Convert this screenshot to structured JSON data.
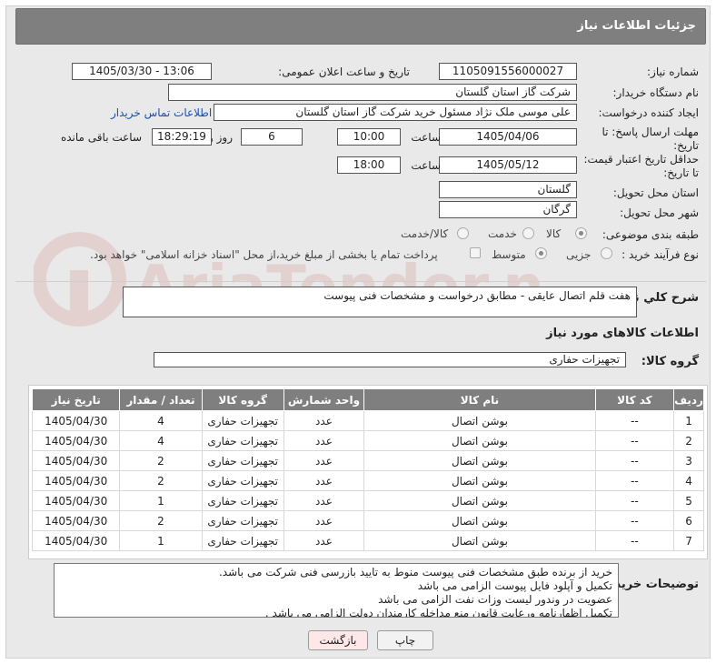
{
  "header": {
    "title": "جزئیات اطلاعات نیاز"
  },
  "fields": {
    "need_number_label": "شماره نیاز:",
    "need_number": "1105091556000027",
    "announce_label": "تاریخ و ساعت اعلان عمومی:",
    "announce_value": "1405/03/30 - 13:06",
    "buyer_org_label": "نام دستگاه خریدار:",
    "buyer_org": "شرکت گاز استان گلستان",
    "requester_label": "ایجاد کننده درخواست:",
    "requester": "علی موسی ملک نژاد مسئول خرید شرکت گاز استان گلستان",
    "contact_link": "اطلاعات تماس خریدار",
    "deadline_label_1": "مهلت ارسال پاسخ: تا",
    "deadline_label_2": "تاریخ:",
    "deadline_date": "1405/04/06",
    "time_label": "ساعت",
    "deadline_time": "10:00",
    "days_value": "6",
    "days_label": "روز و",
    "remaining_time": "18:29:19",
    "remaining_label": "ساعت باقی مانده",
    "validity_label_1": "حداقل تاریخ اعتبار قیمت:",
    "validity_label_2": "تا تاریخ:",
    "validity_date": "1405/05/12",
    "validity_time": "18:00",
    "province_label": "استان محل تحویل:",
    "province": "گلستان",
    "city_label": "شهر محل تحویل:",
    "city": "گرگان",
    "category_label": "طبقه بندی موضوعی:",
    "category_options": [
      "کالا",
      "خدمت",
      "کالا/خدمت"
    ],
    "category_selected": "کالا",
    "process_label": "نوع فرآیند خرید :",
    "process_options": [
      "جزیی",
      "متوسط"
    ],
    "process_selected": "متوسط",
    "payment_note": "پرداخت تمام یا بخشی از مبلغ خرید،از محل \"اسناد خزانه اسلامی\" خواهد بود."
  },
  "summary": {
    "label": "شرح کلي نياز:",
    "value": "هفت قلم اتصال عایقی - مطابق درخواست و مشخصات فنی پیوست"
  },
  "goods_section": {
    "title": "اطلاعات کالاهای مورد نیاز",
    "group_label": "گروه کالا:",
    "group_value": "تجهیزات حفاری"
  },
  "table": {
    "headers": [
      "ردیف",
      "کد کالا",
      "نام کالا",
      "واحد شمارش",
      "گروه کالا",
      "تعداد / مقدار",
      "تاریخ نیاز"
    ],
    "rows": [
      [
        "1",
        "--",
        "بوشن اتصال",
        "عدد",
        "تجهیزات حفاری",
        "4",
        "1405/04/30"
      ],
      [
        "2",
        "--",
        "بوشن اتصال",
        "عدد",
        "تجهیزات حفاری",
        "4",
        "1405/04/30"
      ],
      [
        "3",
        "--",
        "بوشن اتصال",
        "عدد",
        "تجهیزات حفاری",
        "2",
        "1405/04/30"
      ],
      [
        "4",
        "--",
        "بوشن اتصال",
        "عدد",
        "تجهیزات حفاری",
        "2",
        "1405/04/30"
      ],
      [
        "5",
        "--",
        "بوشن اتصال",
        "عدد",
        "تجهیزات حفاری",
        "1",
        "1405/04/30"
      ],
      [
        "6",
        "--",
        "بوشن اتصال",
        "عدد",
        "تجهیزات حفاری",
        "2",
        "1405/04/30"
      ],
      [
        "7",
        "--",
        "بوشن اتصال",
        "عدد",
        "تجهیزات حفاری",
        "1",
        "1405/04/30"
      ]
    ]
  },
  "notes": {
    "label": "توضیحات خریدار:",
    "lines": [
      "خرید از برنده طبق مشخصات فنی پیوست منوط به تایید بازرسی فنی شرکت می باشد.",
      "تکمیل و آپلود فایل پیوست الزامی می باشد",
      "عضویت در وندور لیست وزات نفت  الزامی می باشد",
      "تکمیل اظهارنامه ورعایت قانون منع مداخله کارمندان دولت الزامی می باشد ."
    ]
  },
  "buttons": {
    "back": "بازگشت",
    "print": "چاپ"
  },
  "watermark": {
    "text": "AriaTender.neT"
  },
  "colors": {
    "header_bg": "#7f7f7f",
    "panel_bg": "#e9e9e9",
    "link": "#1a4fb3",
    "back_btn_bg": "#fde7e7",
    "watermark": "#c0392b"
  }
}
